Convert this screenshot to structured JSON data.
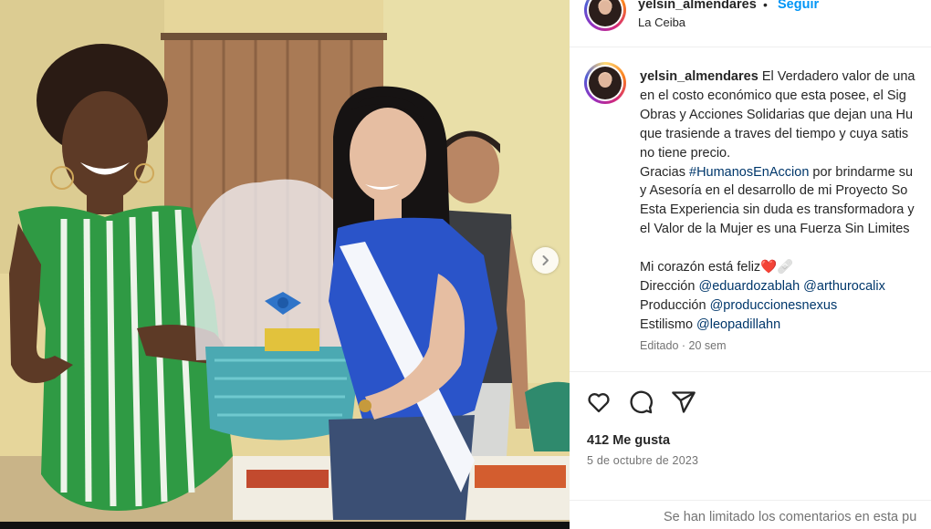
{
  "post": {
    "username": "yelsin_almendares",
    "separator": "•",
    "follow_label": "Seguir",
    "location": "La Ceiba"
  },
  "caption": {
    "username": "yelsin_almendares",
    "lines": [
      "El Verdadero valor de una",
      "en el costo económico que esta posee, el Sig",
      "Obras y Acciones Solidarias que dejan una Hu",
      "que trasiende a traves del tiempo y cuya satis",
      "no tiene precio.",
      "Gracias",
      "#HumanosEnAccion",
      "por brindarme su",
      "y Asesoría en el desarrollo de mi Proyecto So",
      "Esta Experiencia sin duda es transformadora y",
      "el Valor de la Mujer es una Fuerza Sin Limites",
      "Mi corazón está feliz❤️🩹",
      "Dirección",
      "@eduardozablah",
      "@arthurocalix",
      "Producción",
      "@produccionesnexus",
      "Estilismo",
      "@leopadillahn"
    ],
    "meta": "Editado · 20 sem"
  },
  "icons": {
    "like": "heart-icon",
    "comment": "comment-icon",
    "share": "share-icon",
    "next": "chevron-right-icon"
  },
  "stats": {
    "likes": "412 Me gusta",
    "date": "5 de octubre de 2023"
  },
  "comments": {
    "notice": "Se han limitado los comentarios en esta pu"
  },
  "colors": {
    "link_blue": "#0095f6",
    "mention_blue": "#00376b",
    "muted_gray": "#737373"
  }
}
